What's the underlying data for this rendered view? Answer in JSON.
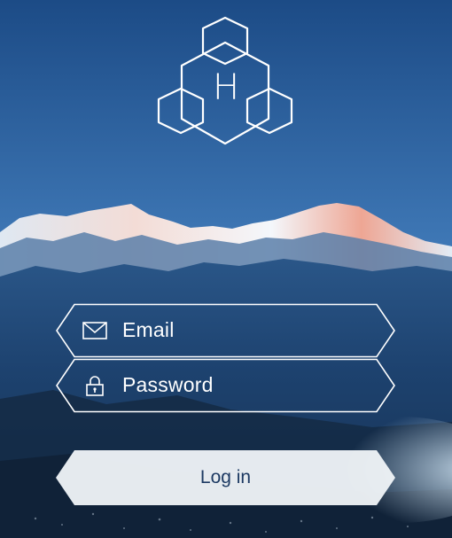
{
  "logo": {
    "letter": "H",
    "icon": "hexagon-logo-icon"
  },
  "form": {
    "email": {
      "placeholder": "Email",
      "icon": "envelope-icon"
    },
    "password": {
      "placeholder": "Password",
      "icon": "padlock-icon"
    },
    "login_label": "Log in"
  },
  "colors": {
    "sky_top": "#1c4b86",
    "sky_mid": "#4f86c0",
    "mountain_snow": "#eef3f8",
    "alpenglow": "#e49a86",
    "valley": "#1a3656",
    "button_fill": "#eef2f6",
    "button_text": "#1d3a63"
  }
}
